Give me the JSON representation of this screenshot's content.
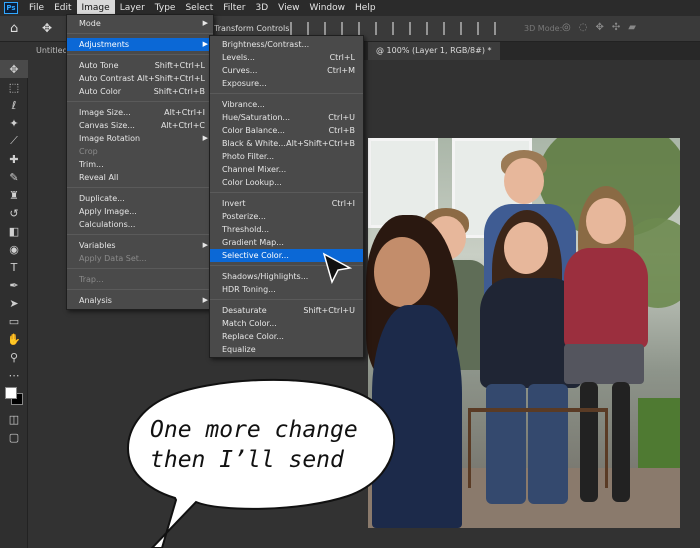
{
  "app": {
    "logo_text": "Ps"
  },
  "menubar": [
    "File",
    "Edit",
    "Image",
    "Layer",
    "Type",
    "Select",
    "Filter",
    "3D",
    "View",
    "Window",
    "Help"
  ],
  "options_bar": {
    "transform_label": "Transform Controls",
    "mode_3d_label": "3D Mode:"
  },
  "tabs": {
    "left": "Untitled",
    "right": "@ 100% (Layer 1, RGB/8#) *"
  },
  "image_menu": [
    {
      "label": "Mode",
      "shortcut": "",
      "submenu": true,
      "disabled": false
    },
    {
      "label": "Adjustments",
      "shortcut": "",
      "submenu": true,
      "disabled": false,
      "highlighted": true
    },
    {
      "label": "Auto Tone",
      "shortcut": "Shift+Ctrl+L",
      "submenu": false,
      "disabled": false
    },
    {
      "label": "Auto Contrast",
      "shortcut": "Alt+Shift+Ctrl+L",
      "submenu": false,
      "disabled": false
    },
    {
      "label": "Auto Color",
      "shortcut": "Shift+Ctrl+B",
      "submenu": false,
      "disabled": false
    },
    {
      "label": "Image Size...",
      "shortcut": "Alt+Ctrl+I",
      "submenu": false,
      "disabled": false
    },
    {
      "label": "Canvas Size...",
      "shortcut": "Alt+Ctrl+C",
      "submenu": false,
      "disabled": false
    },
    {
      "label": "Image Rotation",
      "shortcut": "",
      "submenu": true,
      "disabled": false
    },
    {
      "label": "Crop",
      "shortcut": "",
      "submenu": false,
      "disabled": true
    },
    {
      "label": "Trim...",
      "shortcut": "",
      "submenu": false,
      "disabled": false
    },
    {
      "label": "Reveal All",
      "shortcut": "",
      "submenu": false,
      "disabled": false
    },
    {
      "label": "Duplicate...",
      "shortcut": "",
      "submenu": false,
      "disabled": false
    },
    {
      "label": "Apply Image...",
      "shortcut": "",
      "submenu": false,
      "disabled": false
    },
    {
      "label": "Calculations...",
      "shortcut": "",
      "submenu": false,
      "disabled": false
    },
    {
      "label": "Variables",
      "shortcut": "",
      "submenu": true,
      "disabled": false
    },
    {
      "label": "Apply Data Set...",
      "shortcut": "",
      "submenu": false,
      "disabled": true
    },
    {
      "label": "Trap...",
      "shortcut": "",
      "submenu": false,
      "disabled": true
    },
    {
      "label": "Analysis",
      "shortcut": "",
      "submenu": true,
      "disabled": false
    }
  ],
  "adjustments_menu": [
    {
      "label": "Brightness/Contrast...",
      "shortcut": ""
    },
    {
      "label": "Levels...",
      "shortcut": "Ctrl+L"
    },
    {
      "label": "Curves...",
      "shortcut": "Ctrl+M"
    },
    {
      "label": "Exposure...",
      "shortcut": ""
    },
    {
      "label": "Vibrance...",
      "shortcut": ""
    },
    {
      "label": "Hue/Saturation...",
      "shortcut": "Ctrl+U"
    },
    {
      "label": "Color Balance...",
      "shortcut": "Ctrl+B"
    },
    {
      "label": "Black & White...",
      "shortcut": "Alt+Shift+Ctrl+B"
    },
    {
      "label": "Photo Filter...",
      "shortcut": ""
    },
    {
      "label": "Channel Mixer...",
      "shortcut": ""
    },
    {
      "label": "Color Lookup...",
      "shortcut": ""
    },
    {
      "label": "Invert",
      "shortcut": "Ctrl+I"
    },
    {
      "label": "Posterize...",
      "shortcut": ""
    },
    {
      "label": "Threshold...",
      "shortcut": ""
    },
    {
      "label": "Gradient Map...",
      "shortcut": ""
    },
    {
      "label": "Selective Color...",
      "shortcut": "",
      "highlighted": true
    },
    {
      "label": "Shadows/Highlights...",
      "shortcut": ""
    },
    {
      "label": "HDR Toning...",
      "shortcut": ""
    },
    {
      "label": "Desaturate",
      "shortcut": "Shift+Ctrl+U"
    },
    {
      "label": "Match Color...",
      "shortcut": ""
    },
    {
      "label": "Replace Color...",
      "shortcut": ""
    },
    {
      "label": "Equalize",
      "shortcut": ""
    }
  ],
  "speech_bubble": {
    "line1": "One more change",
    "line2": "then I’ll send"
  },
  "colors": {
    "menu_bg": "#4a4a4a",
    "highlight": "#0b68d6",
    "canvas_bg": "#323232"
  }
}
